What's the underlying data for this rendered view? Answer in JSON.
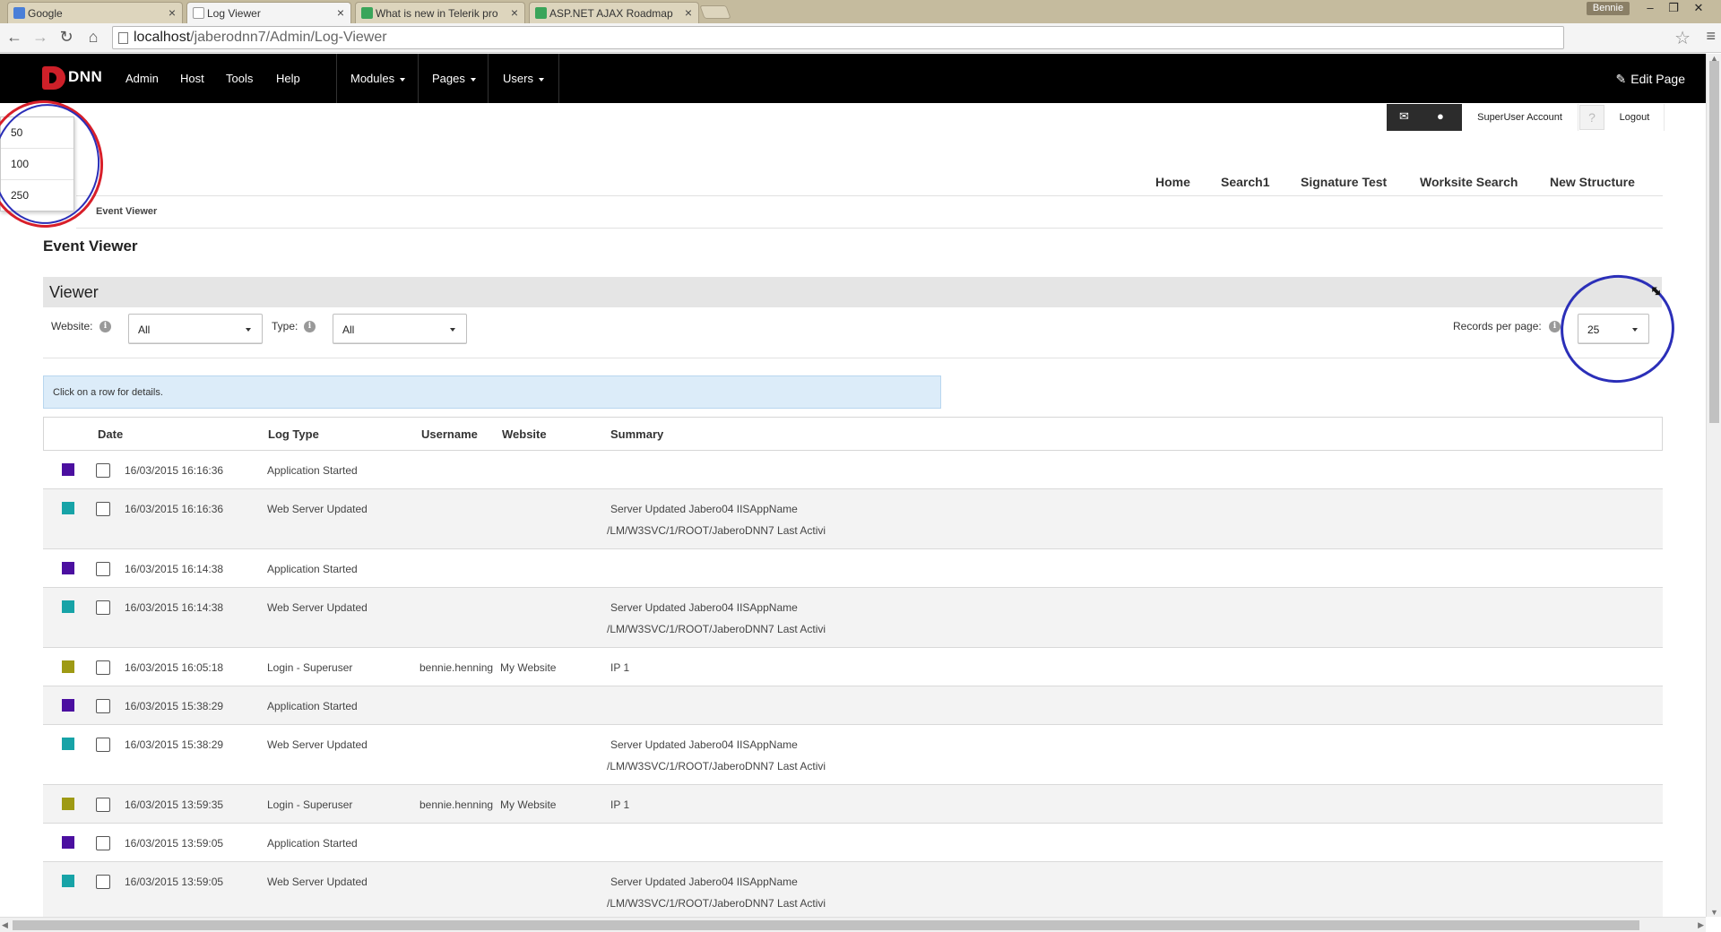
{
  "browser": {
    "tabs": [
      {
        "title": "Google",
        "favicon_color": "#4a7fd8",
        "active": false
      },
      {
        "title": "Log Viewer",
        "favicon_color": "#ffffff",
        "active": true
      },
      {
        "title": "What is new in Telerik pro",
        "favicon_color": "#3aa55a",
        "active": false
      },
      {
        "title": "ASP.NET AJAX Roadmap",
        "favicon_color": "#3aa55a",
        "active": false
      }
    ],
    "user_badge": "Bennie",
    "url_host": "localhost",
    "url_path": "/jaberodnn7/Admin/Log-Viewer"
  },
  "controlbar": {
    "logo_text": "DNN",
    "logo_color": "#ce2029",
    "menu": [
      "Admin",
      "Host",
      "Tools",
      "Help"
    ],
    "dropdown_menu": [
      "Modules",
      "Pages",
      "Users"
    ],
    "edit_page": "Edit Page"
  },
  "userbar": {
    "account": "SuperUser Account",
    "logout": "Logout"
  },
  "site_nav": [
    "Home",
    "Search1",
    "Signature Test",
    "Worksite Search",
    "New Structure"
  ],
  "breadcrumb": "Event Viewer",
  "page_title": "Event Viewer",
  "viewer": {
    "title": "Viewer",
    "website_label": "Website:",
    "website_value": "All",
    "type_label": "Type:",
    "type_value": "All",
    "records_label": "Records per page:",
    "records_value": "25",
    "records_options_open": [
      "50",
      "100",
      "250"
    ],
    "info_message": "Click on a row for details."
  },
  "table": {
    "headers": {
      "date": "Date",
      "log_type": "Log Type",
      "username": "Username",
      "website": "Website",
      "summary": "Summary"
    },
    "type_colors": {
      "app_started": "#4b0fa0",
      "web_server": "#17a3a7",
      "login": "#9e9a14"
    },
    "rows": [
      {
        "date": "16/03/2015 16:16:36",
        "type": "Application Started",
        "color": "#4b0fa0",
        "username": "",
        "website": "",
        "summary1": "",
        "summary2": ""
      },
      {
        "date": "16/03/2015 16:16:36",
        "type": "Web Server Updated",
        "color": "#17a3a7",
        "username": "",
        "website": "",
        "summary1": "Server Updated Jabero04 IISAppName",
        "summary2": "/LM/W3SVC/1/ROOT/JaberoDNN7 Last Activi"
      },
      {
        "date": "16/03/2015 16:14:38",
        "type": "Application Started",
        "color": "#4b0fa0",
        "username": "",
        "website": "",
        "summary1": "",
        "summary2": ""
      },
      {
        "date": "16/03/2015 16:14:38",
        "type": "Web Server Updated",
        "color": "#17a3a7",
        "username": "",
        "website": "",
        "summary1": "Server Updated Jabero04 IISAppName",
        "summary2": "/LM/W3SVC/1/ROOT/JaberoDNN7 Last Activi"
      },
      {
        "date": "16/03/2015 16:05:18",
        "type": "Login - Superuser",
        "color": "#9e9a14",
        "username": "bennie.henning",
        "website": "My Website",
        "summary1": "IP 1",
        "summary2": ""
      },
      {
        "date": "16/03/2015 15:38:29",
        "type": "Application Started",
        "color": "#4b0fa0",
        "username": "",
        "website": "",
        "summary1": "",
        "summary2": ""
      },
      {
        "date": "16/03/2015 15:38:29",
        "type": "Web Server Updated",
        "color": "#17a3a7",
        "username": "",
        "website": "",
        "summary1": "Server Updated Jabero04 IISAppName",
        "summary2": "/LM/W3SVC/1/ROOT/JaberoDNN7 Last Activi"
      },
      {
        "date": "16/03/2015 13:59:35",
        "type": "Login - Superuser",
        "color": "#9e9a14",
        "username": "bennie.henning",
        "website": "My Website",
        "summary1": "IP 1",
        "summary2": ""
      },
      {
        "date": "16/03/2015 13:59:05",
        "type": "Application Started",
        "color": "#4b0fa0",
        "username": "",
        "website": "",
        "summary1": "",
        "summary2": ""
      },
      {
        "date": "16/03/2015 13:59:05",
        "type": "Web Server Updated",
        "color": "#17a3a7",
        "username": "",
        "website": "",
        "summary1": "Server Updated Jabero04 IISAppName",
        "summary2": "/LM/W3SVC/1/ROOT/JaberoDNN7 Last Activi"
      }
    ]
  },
  "annotations": {
    "left_ring_colors": [
      "#d81f2a",
      "#2b2fb8"
    ],
    "right_ring_color": "#2b2fb8"
  }
}
